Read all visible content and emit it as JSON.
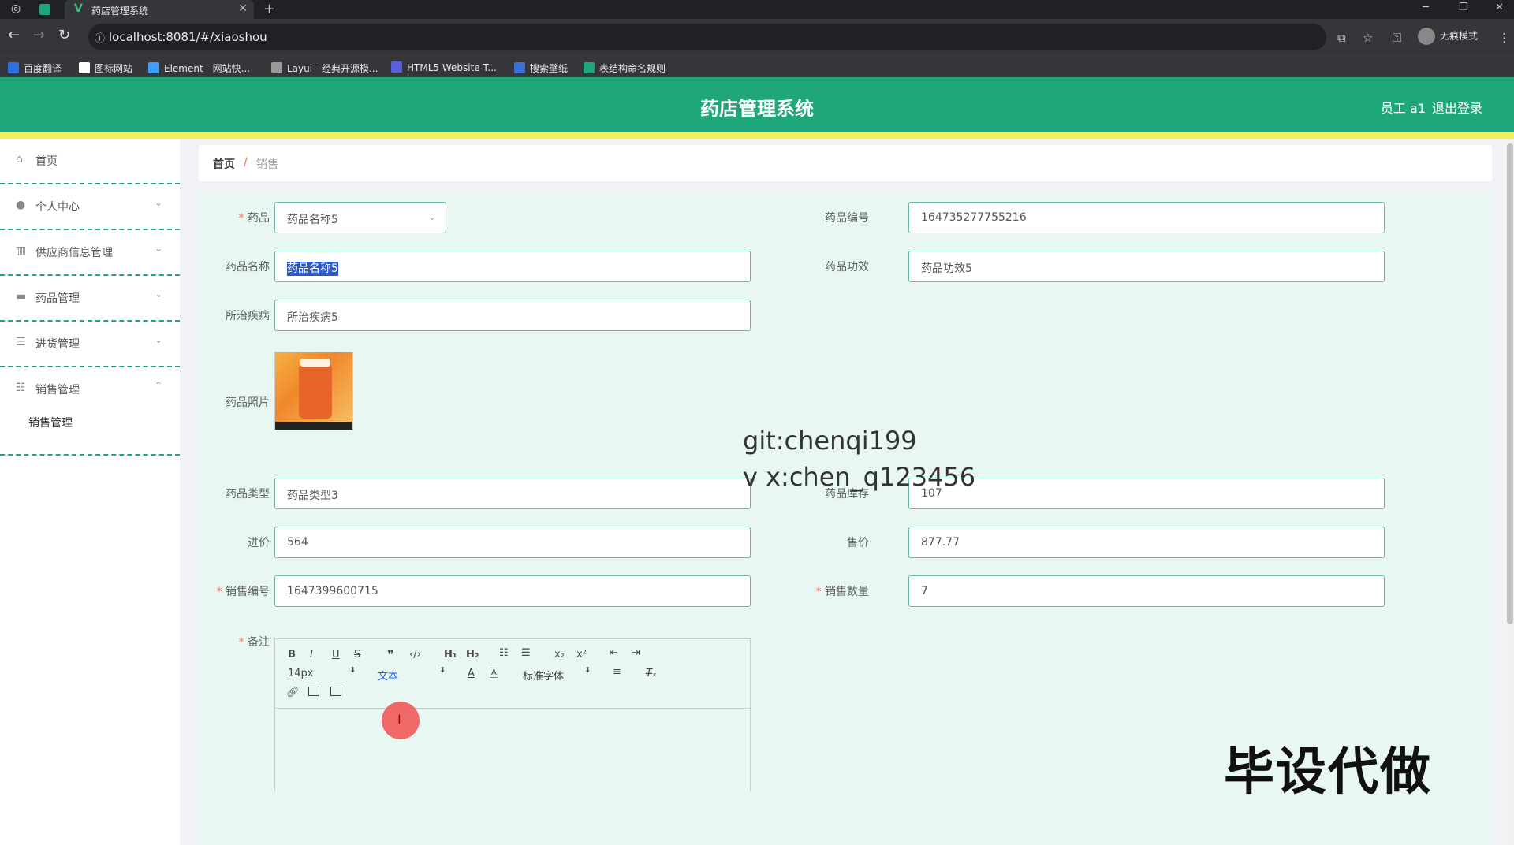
{
  "browser": {
    "tab_title": "药店管理系统",
    "tab_close": "✕",
    "new_tab": "+",
    "url": "localhost:8081/#/xiaoshou",
    "incognito_label": "无痕模式",
    "bookmarks": [
      {
        "label": "百度翻译",
        "color": "#2f6fe0"
      },
      {
        "label": "图标网站",
        "color": "#222222"
      },
      {
        "label": "Element - 网站快...",
        "color": "#409eff"
      },
      {
        "label": "Layui - 经典开源模...",
        "color": "#999999"
      },
      {
        "label": "HTML5 Website T...",
        "color": "#5a5fe0"
      },
      {
        "label": "搜索壁纸",
        "color": "#3a6fd8"
      },
      {
        "label": "表结构命名规则",
        "color": "#1fa67a"
      }
    ]
  },
  "header": {
    "title": "药店管理系统",
    "user": "员工 a1",
    "logout": "退出登录",
    "color": "#1fa67a",
    "stripe_color": "#f2ef5c"
  },
  "sidebar": {
    "items": [
      {
        "label": "首页",
        "icon": "home-icon",
        "chevron": ""
      },
      {
        "label": "个人中心",
        "icon": "user-icon",
        "chevron": "⌄"
      },
      {
        "label": "供应商信息管理",
        "icon": "building-icon",
        "chevron": "⌄"
      },
      {
        "label": "药品管理",
        "icon": "monitor-icon",
        "chevron": "⌄"
      },
      {
        "label": "进货管理",
        "icon": "list-icon",
        "chevron": "⌄"
      },
      {
        "label": "销售管理",
        "icon": "sliders-icon",
        "chevron": "⌃"
      }
    ],
    "submenu": "销售管理"
  },
  "breadcrumb": {
    "home": "首页",
    "sep": "/",
    "current": "销售"
  },
  "form": {
    "drug_label": "药品",
    "drug_value": "药品名称5",
    "code_label": "药品编号",
    "code_value": "164735277755216",
    "name_label": "药品名称",
    "name_value": "药品名称5",
    "effect_label": "药品功效",
    "effect_value": "药品功效5",
    "disease_label": "所治疾病",
    "disease_value": "所治疾病5",
    "photo_label": "药品照片",
    "type_label": "药品类型",
    "type_value": "药品类型3",
    "stock_label": "药品库存",
    "stock_value": "107",
    "cost_label": "进价",
    "cost_value": "564",
    "price_label": "售价",
    "price_value": "877.77",
    "sale_no_label": "销售编号",
    "sale_no_value": "1647399600715",
    "qty_label": "销售数量",
    "qty_value": "7",
    "remark_label": "备注"
  },
  "editor": {
    "font_size": "14px",
    "format": "文本",
    "font": "标准字体"
  },
  "watermarks": {
    "line1": "git:chenqi199",
    "line2": "v x:chen_q123456",
    "big": "毕设代做"
  }
}
